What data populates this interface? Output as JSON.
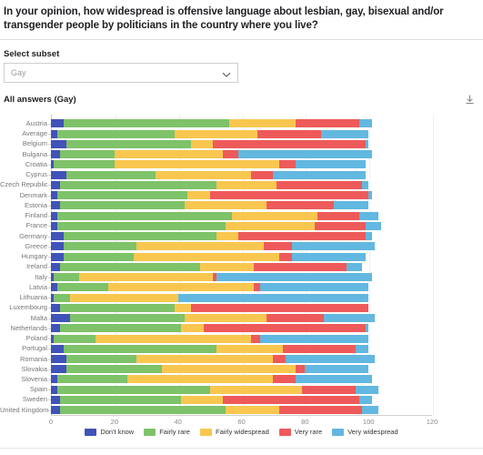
{
  "question": "In your opinion, how widespread is offensive language about lesbian, gay, bisexual and/or transgender people by politicians in the country where you live?",
  "subset": {
    "label": "Select subset",
    "value": "Gay",
    "chevron_icon": "chevron-down-icon"
  },
  "section": {
    "title": "All answers (Gay)",
    "download_icon": "download-icon"
  },
  "chart_data": {
    "type": "bar",
    "orientation": "horizontal",
    "stacked": true,
    "title": "All answers (Gay)",
    "xlabel": "",
    "ylabel": "",
    "xlim": [
      0,
      120
    ],
    "xticks": [
      0,
      20,
      40,
      60,
      80,
      100,
      120
    ],
    "grid": true,
    "legend_position": "bottom",
    "colors": {
      "Don't know": "#4053b8",
      "Fairly rare": "#7ec269",
      "Fairly widespread": "#f9c council",
      "Very rare": "#ee5a5a",
      "Very widespread": "#62b8e0"
    },
    "series_colors": [
      "#4053b8",
      "#7ec269",
      "#f8c council",
      "#ee5a5a",
      "#62b8e0"
    ],
    "legend": [
      "Don't know",
      "Fairly rare",
      "Fairly widespread",
      "Very rare",
      "Very widespread"
    ],
    "categories": [
      "Austria",
      "Average",
      "Belgium",
      "Bulgaria",
      "Croatia",
      "Cyprus",
      "Czech Republic",
      "Denmark",
      "Estonia",
      "Finland",
      "France",
      "Germany",
      "Greece",
      "Hungary",
      "Ireland",
      "Italy",
      "Latvia",
      "Lithuania",
      "Luxembourg",
      "Malta",
      "Netherlands",
      "Poland",
      "Portugal",
      "Romania",
      "Slovakia",
      "Slovenia",
      "Spain",
      "Sweden",
      "United Kingdom"
    ],
    "series": [
      {
        "name": "Don't know",
        "values": [
          4,
          2,
          5,
          3,
          1,
          5,
          3,
          2,
          3,
          2,
          2,
          4,
          4,
          4,
          3,
          1,
          2,
          1,
          3,
          6,
          3,
          1,
          4,
          5,
          5,
          2,
          2,
          3,
          3
        ]
      },
      {
        "name": "Fairly rare",
        "values": [
          52,
          37,
          39,
          17,
          19,
          28,
          49,
          41,
          39,
          55,
          53,
          48,
          23,
          22,
          44,
          8,
          16,
          5,
          36,
          36,
          38,
          13,
          48,
          22,
          30,
          22,
          48,
          38,
          52
        ]
      },
      {
        "name": "Fairly widespread",
        "values": [
          21,
          26,
          7,
          34,
          52,
          30,
          19,
          7,
          26,
          27,
          28,
          7,
          40,
          46,
          17,
          42,
          46,
          34,
          5,
          26,
          7,
          49,
          21,
          43,
          42,
          46,
          29,
          13,
          17
        ]
      },
      {
        "name": "Very rare",
        "values": [
          20,
          20,
          48,
          5,
          5,
          7,
          27,
          50,
          21,
          13,
          16,
          40,
          9,
          4,
          29,
          1,
          2,
          0,
          56,
          18,
          51,
          3,
          23,
          4,
          3,
          7,
          17,
          43,
          26
        ]
      },
      {
        "name": "Very widespread",
        "values": [
          4,
          15,
          1,
          42,
          22,
          29,
          2,
          1,
          11,
          6,
          5,
          2,
          26,
          23,
          5,
          49,
          34,
          60,
          0,
          16,
          1,
          34,
          4,
          28,
          20,
          24,
          7,
          4,
          5
        ]
      }
    ]
  }
}
